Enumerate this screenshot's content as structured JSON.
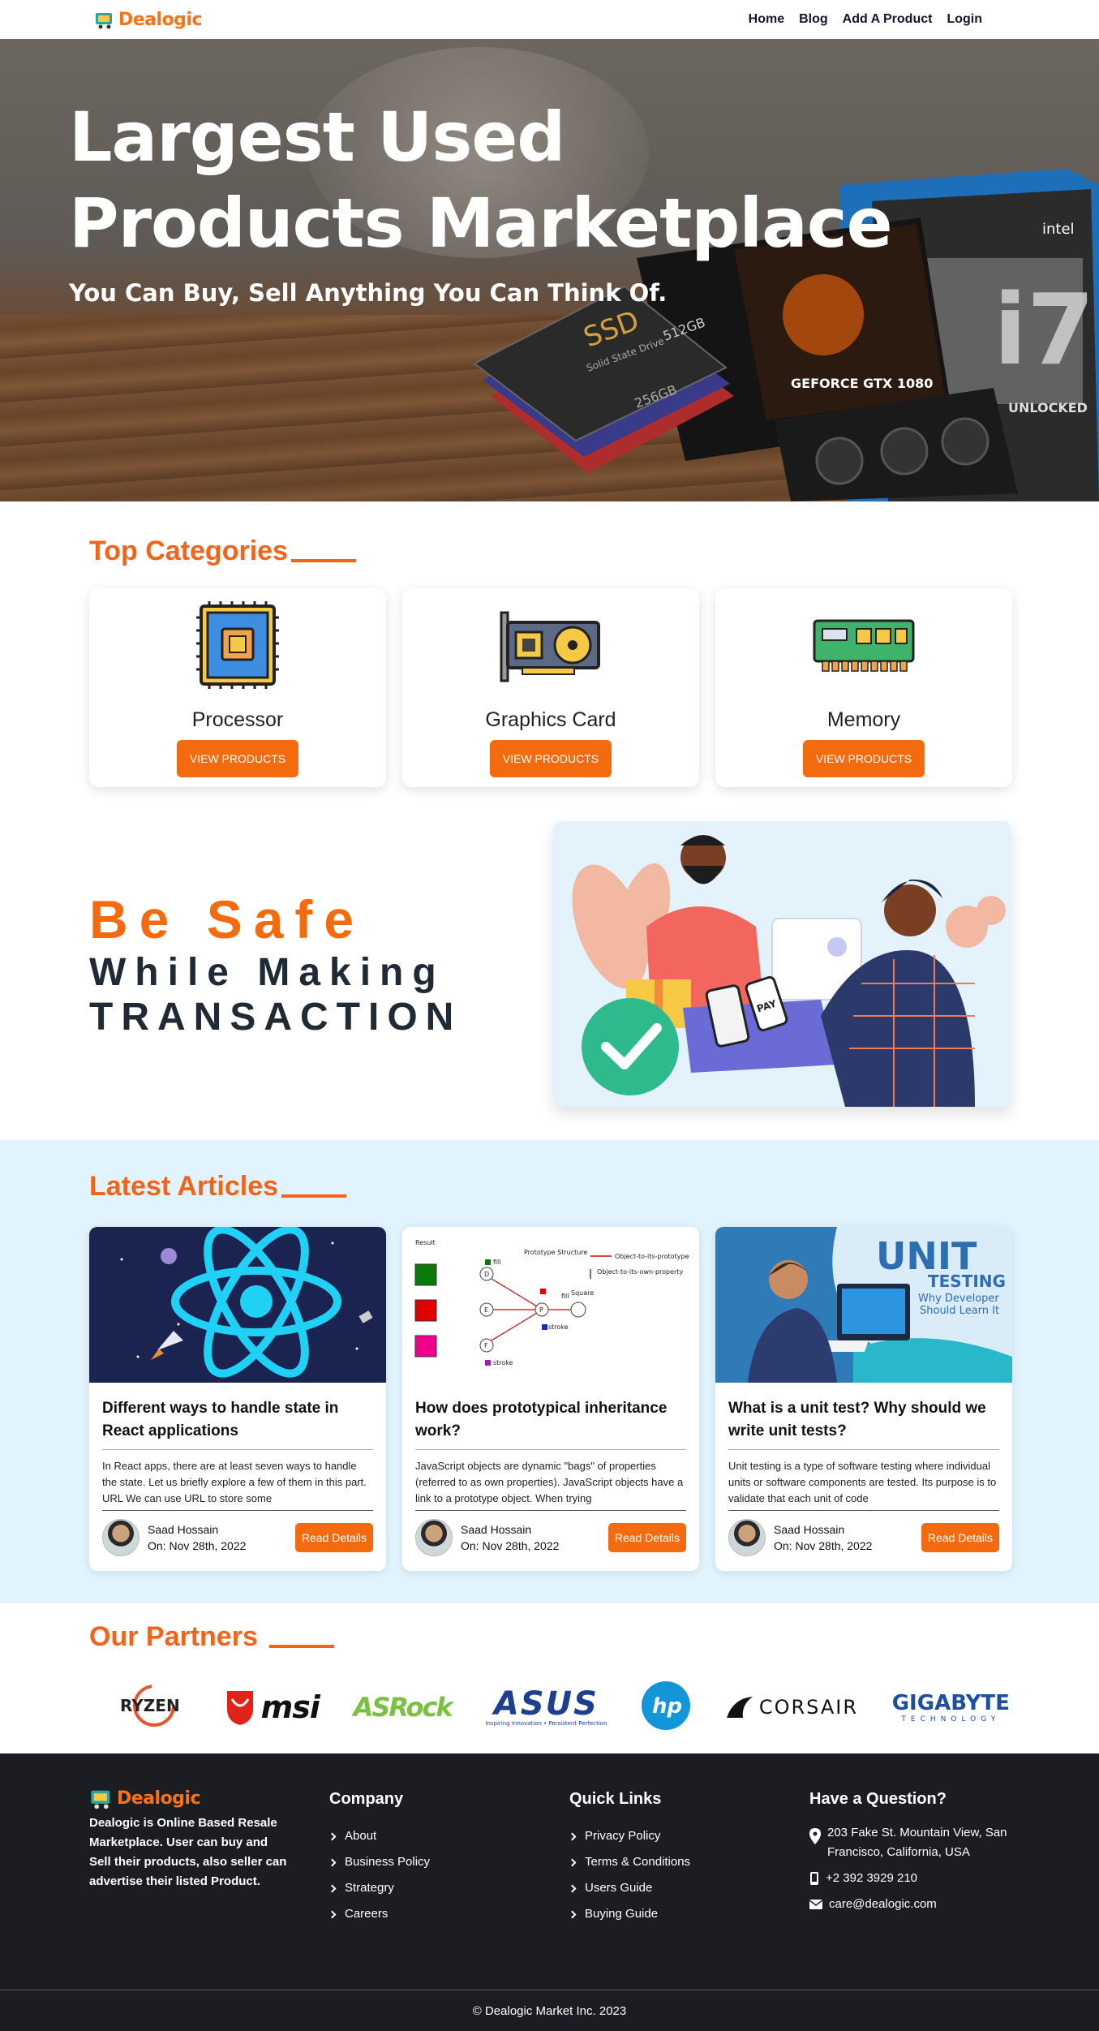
{
  "nav": {
    "brand": "Dealogic",
    "links": [
      "Home",
      "Blog",
      "Add A Product",
      "Login"
    ]
  },
  "hero": {
    "title": "Largest Used\nProducts Marketplace",
    "subtitle": "You Can Buy, Sell Anything You Can Think Of.",
    "product_labels": {
      "ssd": "SSD",
      "ssd_caption": "Solid State Drive",
      "ssd_size": "512GB",
      "ssd2_size": "256GB",
      "gpu": "GEFORCE GTX 1080",
      "cpu_brand": "intel",
      "cpu": "i7",
      "cpu_tag": "UNLOCKED"
    }
  },
  "categories": {
    "title": "Top Categories",
    "items": [
      {
        "name": "Processor",
        "button": "VIEW PRODUCTS",
        "icon": "processor-icon"
      },
      {
        "name": "Graphics Card",
        "button": "VIEW PRODUCTS",
        "icon": "graphics-card-icon"
      },
      {
        "name": "Memory",
        "button": "VIEW PRODUCTS",
        "icon": "memory-icon"
      }
    ]
  },
  "safe": {
    "line1": "Be Safe",
    "line2": "While Making",
    "line3": "TRANSACTION",
    "pay_label": "PAY"
  },
  "articles": {
    "title": "Latest Articles",
    "items": [
      {
        "title": "Different ways to handle state in React applications",
        "excerpt": "In React apps, there are at least seven ways to handle the state. Let us briefly explore a few of them in this part. URL We can use URL to store some",
        "author": "Saad Hossain",
        "date": "On: Nov 28th, 2022",
        "button": "Read Details"
      },
      {
        "title": "How does prototypical inheritance work?",
        "excerpt": "JavaScript objects are dynamic \"bags\" of properties (referred to as own properties). JavaScript objects have a link to a prototype object. When trying",
        "author": "Saad Hossain",
        "date": "On: Nov 28th, 2022",
        "button": "Read Details",
        "diagram": {
          "result": "Result",
          "proto": "Prototype Structure",
          "legend1": "Object-to-its-prototype",
          "legend2": "Object-to-its-own-property",
          "fill": "fill",
          "square": "Square",
          "stroke": "stroke",
          "nodes": [
            "D",
            "E",
            "P",
            "F"
          ]
        }
      },
      {
        "title": "What is a unit test? Why should we write unit tests?",
        "excerpt": "Unit testing is a type of software testing where individual units or software components are tested. Its purpose is to validate that each unit of code",
        "author": "Saad Hossain",
        "date": "On: Nov 28th, 2022",
        "button": "Read Details",
        "banner": {
          "l1": "UNIT",
          "l2": "TESTING",
          "l3": "Why Developer",
          "l4": "Should Learn It"
        }
      }
    ]
  },
  "partners": {
    "title": "Our Partners",
    "logos": [
      "RYZEN",
      "msi",
      "ASRock",
      "ASUS",
      "hp",
      "CORSAIR",
      "GIGABYTE"
    ],
    "asus_tagline": "Inspiring Innovation • Persistent Perfection",
    "gigabyte_tagline": "TECHNOLOGY"
  },
  "footer": {
    "brand": "Dealogic",
    "about": "Dealogic is Online Based Resale Marketplace. User can buy and Sell their products, also seller can advertise their listed Product.",
    "company": {
      "title": "Company",
      "links": [
        "About",
        "Business Policy",
        "Strategry",
        "Careers"
      ]
    },
    "quick": {
      "title": "Quick Links",
      "links": [
        "Privacy Policy",
        "Terms & Conditions",
        "Users Guide",
        "Buying Guide"
      ]
    },
    "contact": {
      "title": "Have a Question?",
      "address": "203 Fake St. Mountain View, San Francisco, California, USA",
      "phone": "+2 392 3929 210",
      "email": "care@dealogic.com"
    },
    "copyright": "© Dealogic Market Inc. 2023"
  },
  "colors": {
    "accent": "#f46a0f",
    "dark": "#1c1d22",
    "articles_bg": "#e1f3fc"
  }
}
